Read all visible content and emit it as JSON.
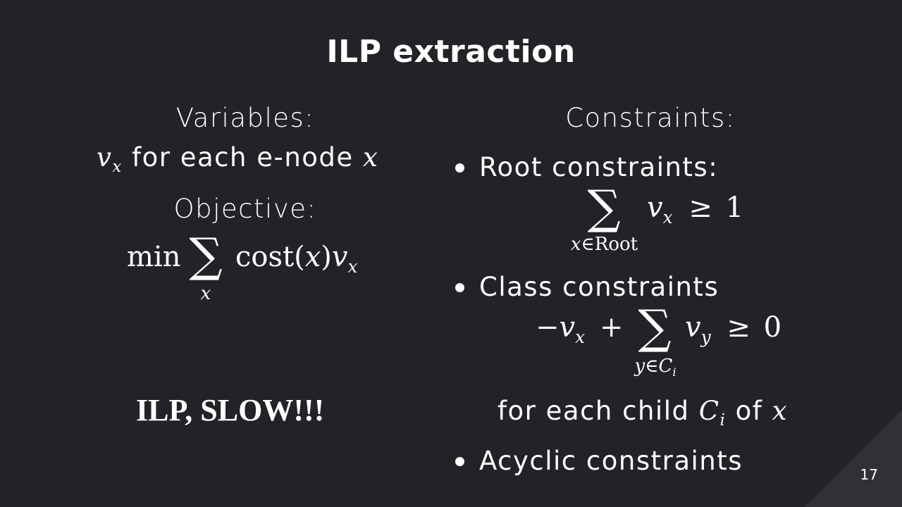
{
  "title": "ILP extraction",
  "left": {
    "variables_heading": "Variables:",
    "variables_line": {
      "var": "v",
      "var_sub": "x",
      "text": " for each e-node ",
      "node": "x"
    },
    "objective_heading": "Objective:",
    "objective_formula": {
      "op": "min",
      "sum": "∑",
      "sum_limit": "x",
      "func": "cost",
      "paren_open": "(",
      "arg": "x",
      "paren_close": ")",
      "var": "v",
      "var_sub": "x"
    },
    "slow_label": "ILP, SLOW!!!"
  },
  "right": {
    "constraints_heading": "Constraints:",
    "root": {
      "label": "Root constraints:",
      "formula": {
        "sum": "∑",
        "limit_var": "x",
        "limit_in": "∈",
        "limit_set": "Root",
        "var": "v",
        "var_sub": "x",
        "rel": "≥",
        "rhs": "1"
      }
    },
    "class": {
      "label": "Class constraints",
      "formula": {
        "neg_term": "−v",
        "neg_sub": "x",
        "plus": "+",
        "sum": "∑",
        "limit_var": "y",
        "limit_in": "∈",
        "limit_set": "C",
        "limit_set_sub": "i",
        "var": "v",
        "var_sub": "y",
        "rel": "≥",
        "rhs": "0"
      },
      "for_each": {
        "text1": "for each child ",
        "child": "C",
        "child_sub": "i",
        "text2": " of ",
        "node": "x"
      }
    },
    "acyclic": {
      "label": "Acyclic constraints"
    }
  },
  "page_number": "17"
}
